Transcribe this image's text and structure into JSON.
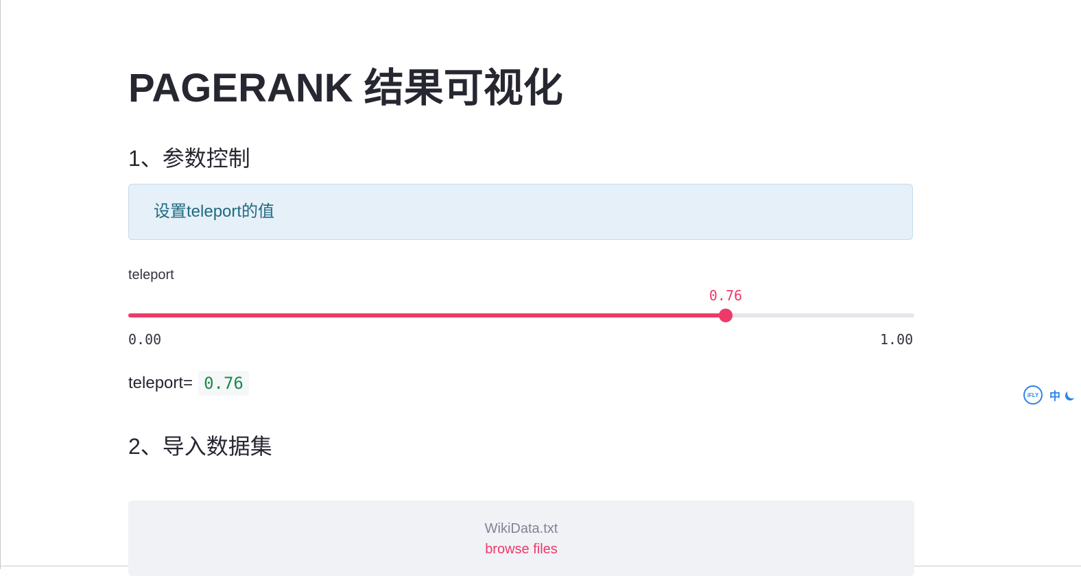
{
  "page": {
    "title": "PAGERANK 结果可视化"
  },
  "section1": {
    "title": "1、参数控制",
    "info": "设置teleport的值"
  },
  "slider": {
    "label": "teleport",
    "value": 0.76,
    "value_text": "0.76",
    "min": 0,
    "max": 1,
    "min_text": "0.00",
    "max_text": "1.00",
    "accent_color": "#ed3a6a"
  },
  "result": {
    "label": "teleport=",
    "value": "0.76"
  },
  "section2": {
    "title": "2、导入数据集"
  },
  "uploader": {
    "file_name": "WikiData.txt",
    "browse_label": "browse files"
  },
  "ifly_widget": {
    "logo_text": "iFLY",
    "lang_label": "中",
    "logo_icon": "ifly-logo-icon",
    "mode_icon": "moon-icon"
  }
}
